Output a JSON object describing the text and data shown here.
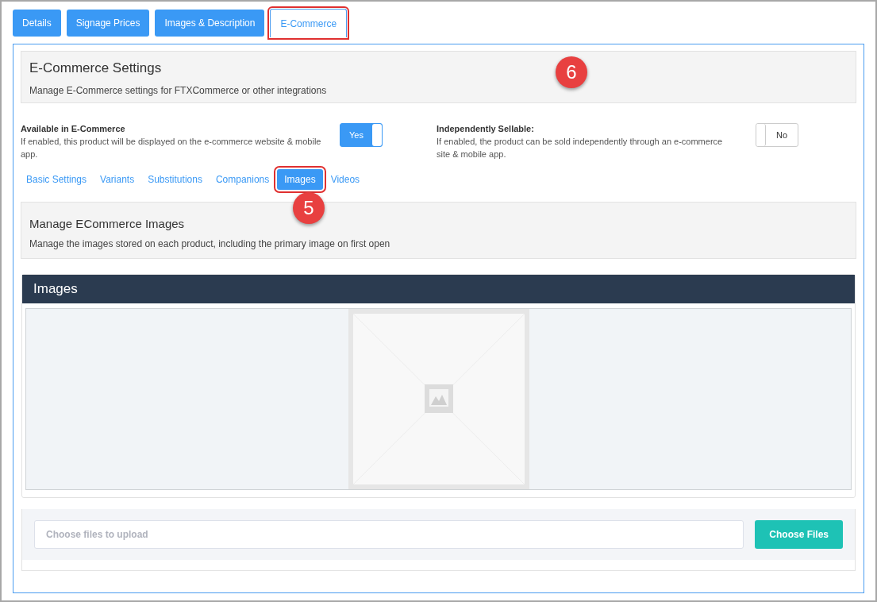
{
  "tabs": [
    {
      "label": "Details",
      "selected": false,
      "highlighted": false
    },
    {
      "label": "Signage Prices",
      "selected": false,
      "highlighted": false
    },
    {
      "label": "Images & Description",
      "selected": false,
      "highlighted": false
    },
    {
      "label": "E-Commerce",
      "selected": true,
      "highlighted": true
    }
  ],
  "settings_header": {
    "title": "E-Commerce Settings",
    "description": "Manage E-Commerce settings for FTXCommerce or other integrations",
    "callout": "6"
  },
  "toggles": [
    {
      "label": "Available in E-Commerce",
      "description": "If enabled, this product will be displayed on the e-commerce website & mobile app.",
      "on": true,
      "value": "Yes"
    },
    {
      "label": "Independently Sellable:",
      "description": "If enabled, the product can be sold independently through an e-commerce site & mobile app.",
      "on": false,
      "value": "No"
    }
  ],
  "sub_tabs": [
    {
      "label": "Basic Settings",
      "selected": false,
      "highlighted": false
    },
    {
      "label": "Variants",
      "selected": false,
      "highlighted": false
    },
    {
      "label": "Substitutions",
      "selected": false,
      "highlighted": false
    },
    {
      "label": "Companions",
      "selected": false,
      "highlighted": false
    },
    {
      "label": "Images",
      "selected": true,
      "highlighted": true
    },
    {
      "label": "Videos",
      "selected": false,
      "highlighted": false
    }
  ],
  "sub_tab_callout": "5",
  "images_header": {
    "title": "Manage ECommerce Images",
    "description": "Manage the images stored on each product, including the primary image on first open"
  },
  "images_panel": {
    "title": "Images"
  },
  "upload": {
    "placeholder": "Choose files to upload",
    "button": "Choose Files"
  }
}
